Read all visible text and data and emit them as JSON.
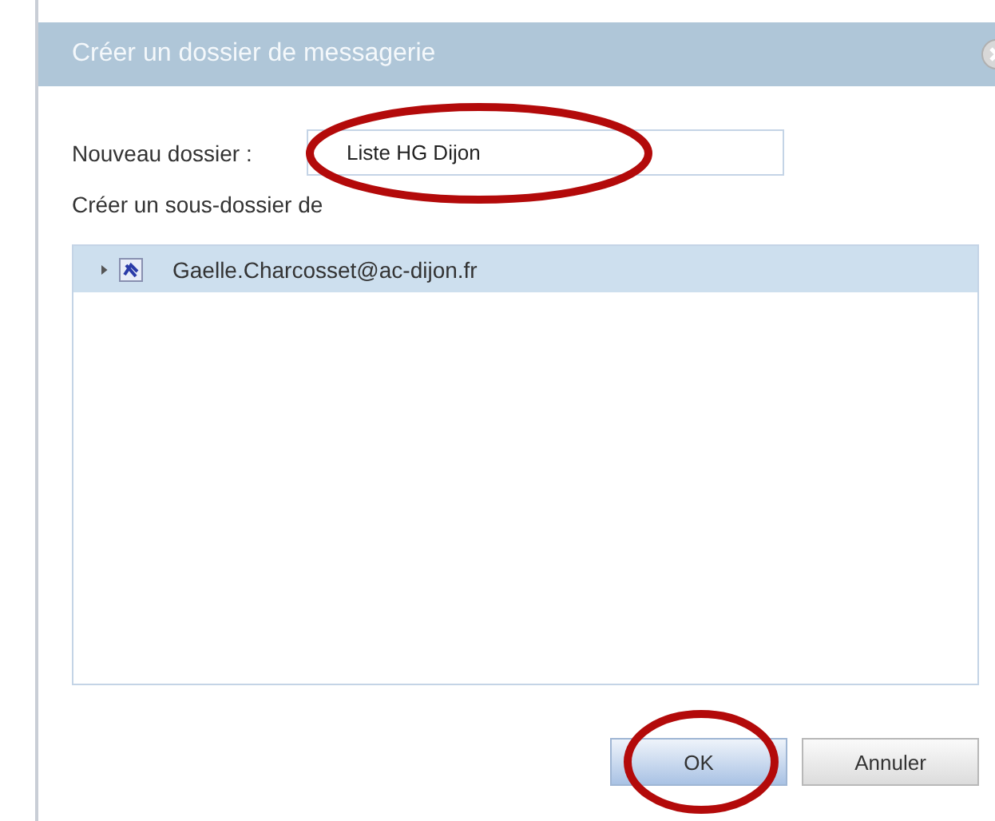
{
  "dialog": {
    "title": "Créer un dossier de messagerie",
    "name_field": {
      "label": "Nouveau dossier :",
      "value": "Liste HG Dijon",
      "circled": true
    },
    "parent_label": "Créer un sous-dossier de",
    "tree": [
      {
        "label": "Gaelle.Charcosset@ac-dijon.fr",
        "selected": true,
        "expanded": false
      }
    ],
    "buttons": [
      {
        "label": "OK",
        "kind": "primary",
        "circled": true
      },
      {
        "label": "Annuler",
        "kind": "secondary",
        "circled": false
      }
    ]
  }
}
